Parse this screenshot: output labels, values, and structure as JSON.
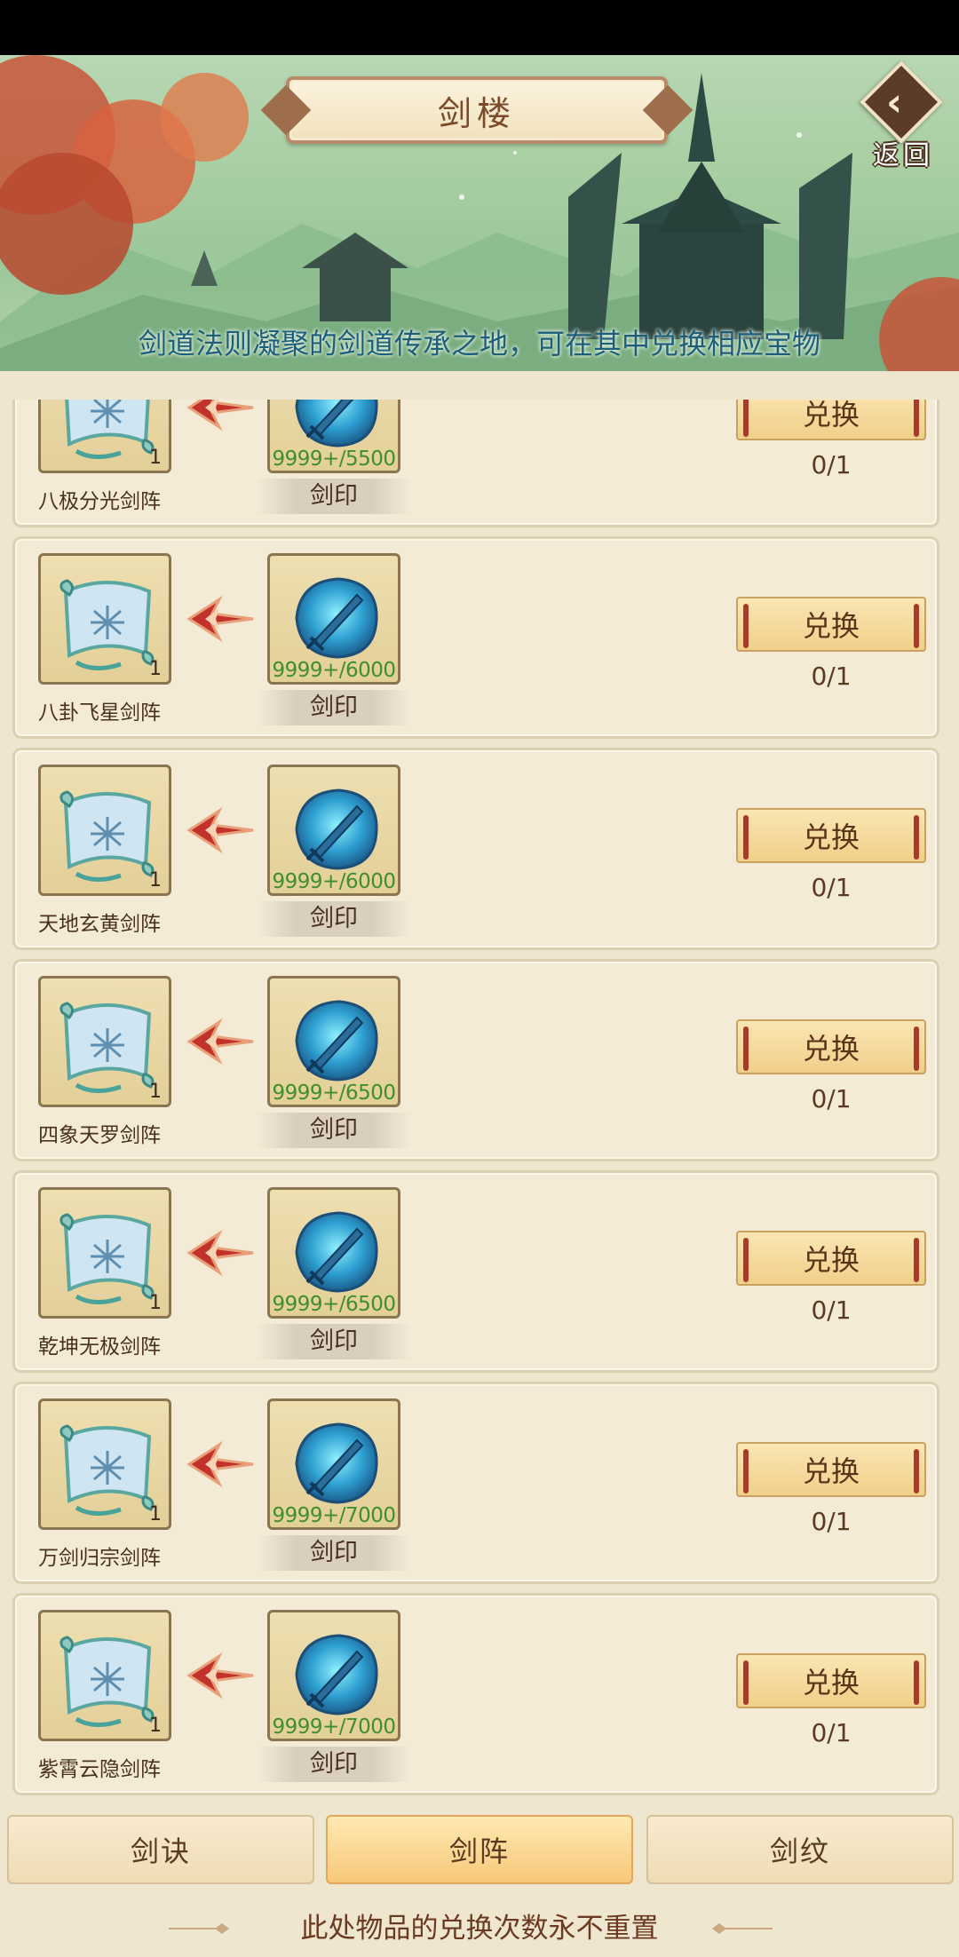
{
  "header": {
    "title": "剑楼",
    "back_label": "返回",
    "subtitle": "剑道法则凝聚的剑道传承之地，可在其中兑换相应宝物"
  },
  "items": [
    {
      "name": "八极分光剑阵",
      "quantity": "1",
      "cost_name": "剑印",
      "cost_count": "9999+/5500",
      "button_label": "兑换",
      "limit": "0/1"
    },
    {
      "name": "八卦飞星剑阵",
      "quantity": "1",
      "cost_name": "剑印",
      "cost_count": "9999+/6000",
      "button_label": "兑换",
      "limit": "0/1"
    },
    {
      "name": "天地玄黄剑阵",
      "quantity": "1",
      "cost_name": "剑印",
      "cost_count": "9999+/6000",
      "button_label": "兑换",
      "limit": "0/1"
    },
    {
      "name": "四象天罗剑阵",
      "quantity": "1",
      "cost_name": "剑印",
      "cost_count": "9999+/6500",
      "button_label": "兑换",
      "limit": "0/1"
    },
    {
      "name": "乾坤无极剑阵",
      "quantity": "1",
      "cost_name": "剑印",
      "cost_count": "9999+/6500",
      "button_label": "兑换",
      "limit": "0/1"
    },
    {
      "name": "万剑归宗剑阵",
      "quantity": "1",
      "cost_name": "剑印",
      "cost_count": "9999+/7000",
      "button_label": "兑换",
      "limit": "0/1"
    },
    {
      "name": "紫霄云隐剑阵",
      "quantity": "1",
      "cost_name": "剑印",
      "cost_count": "9999+/7000",
      "button_label": "兑换",
      "limit": "0/1"
    }
  ],
  "tabs": [
    {
      "label": "剑诀",
      "active": false
    },
    {
      "label": "剑阵",
      "active": true
    },
    {
      "label": "剑纹",
      "active": false
    }
  ],
  "footer_note": "此处物品的兑换次数永不重置",
  "icons": {
    "reward": "scroll-icon",
    "cost": "sword-seal-icon",
    "arrow": "exchange-arrow-icon",
    "back": "back-icon"
  },
  "colors": {
    "cost_count": "#3f8f2a",
    "subtitle": "#1d5f7b",
    "active_tab": "#f7c87a"
  }
}
